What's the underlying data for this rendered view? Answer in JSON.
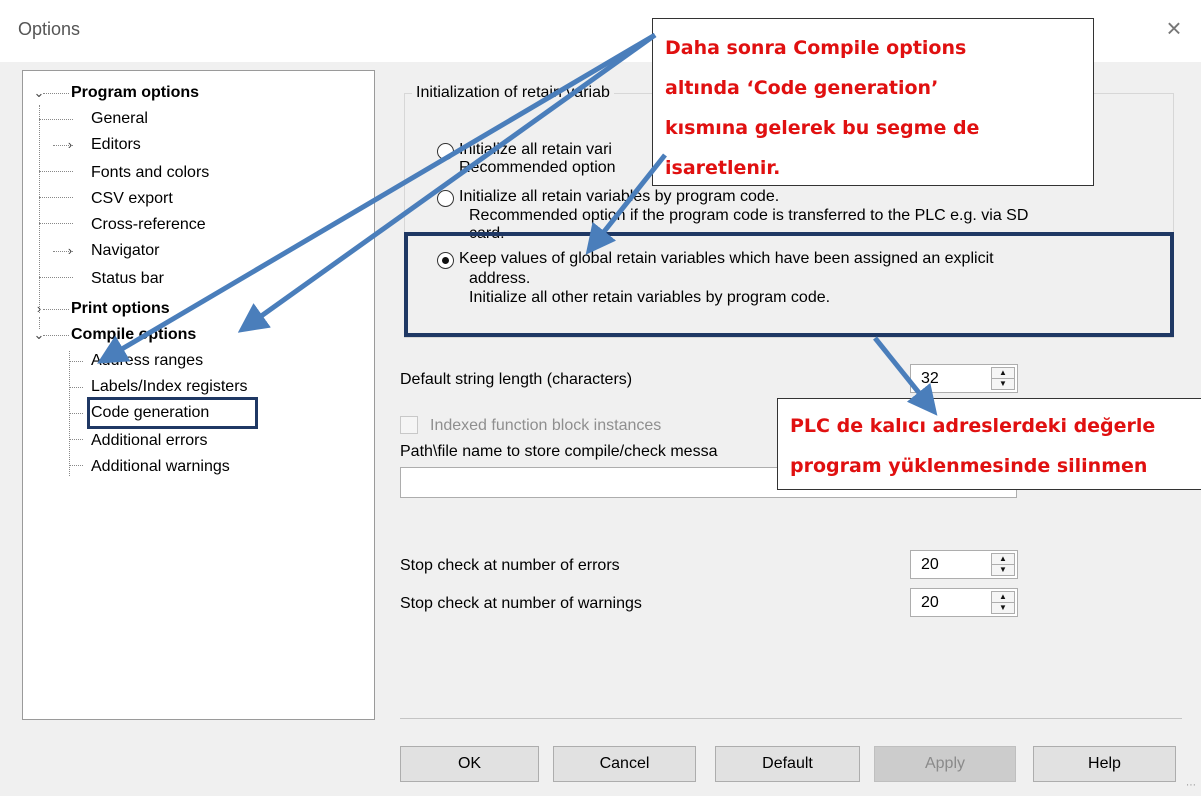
{
  "window": {
    "title": "Options",
    "close_glyph": "×"
  },
  "tree": {
    "items": [
      {
        "label": "Program options",
        "bold": true,
        "twisty": "expanded"
      },
      {
        "label": "General"
      },
      {
        "label": "Editors",
        "twisty": "collapsed"
      },
      {
        "label": "Fonts and colors"
      },
      {
        "label": "CSV export"
      },
      {
        "label": "Cross-reference"
      },
      {
        "label": "Navigator",
        "twisty": "collapsed"
      },
      {
        "label": "Status bar"
      },
      {
        "label": "Print options",
        "bold": true,
        "twisty": "collapsed"
      },
      {
        "label": "Compile options",
        "bold": true,
        "twisty": "expanded"
      },
      {
        "label": "Address ranges"
      },
      {
        "label": "Labels/Index registers"
      },
      {
        "label": "Code generation",
        "selected": true
      },
      {
        "label": "Additional errors"
      },
      {
        "label": "Additional warnings"
      }
    ]
  },
  "retain_group": {
    "legend": "Initialization of retain variab",
    "options": [
      {
        "line1": "Initialize all retain vari",
        "line2": "Recommended option",
        "checked": false
      },
      {
        "line1": "Initialize all retain variables by program code.",
        "line2": "Recommended option if the program code is transferred to the PLC e.g. via SD",
        "line3": "card.",
        "checked": false
      },
      {
        "line1": "Keep values of global retain variables which have been assigned an explicit",
        "line2": "address.",
        "line3": "Initialize all other retain variables by program code.",
        "checked": true
      }
    ]
  },
  "fields": {
    "string_length_label": "Default string length (characters)",
    "string_length_value": "32",
    "indexed_fb_label": "Indexed function block instances",
    "path_label": "Path\\file name to store compile/check messa",
    "path_value": "",
    "stop_errors_label": "Stop check at number of errors",
    "stop_errors_value": "20",
    "stop_warnings_label": "Stop check at number of warnings",
    "stop_warnings_value": "20"
  },
  "buttons": {
    "ok": "OK",
    "cancel": "Cancel",
    "default": "Default",
    "apply": "Apply",
    "help": "Help"
  },
  "annotations": {
    "callout_top": [
      "Daha sonra Compile options",
      "altında ‘Code generation’",
      "kısmına gelerek bu segme de",
      "isaretlenir."
    ],
    "callout_bottom": [
      "PLC de kalıcı adreslerdeki değerle",
      "program yüklenmesinde silinmen"
    ]
  },
  "colors": {
    "annotation_text": "#e01010",
    "arrow": "#4a7ebb",
    "highlight_border": "#1f3864"
  }
}
